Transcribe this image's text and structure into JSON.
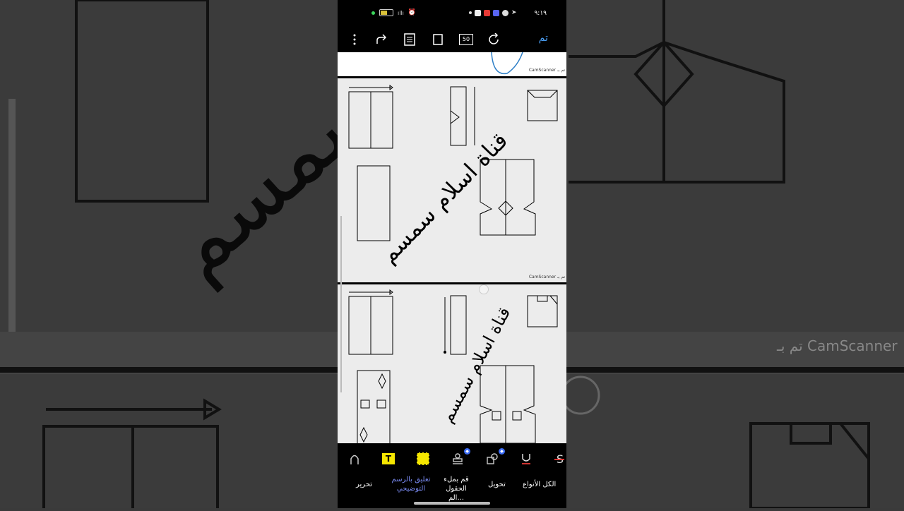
{
  "status_bar": {
    "time": "٩:١٩"
  },
  "toolbar": {
    "done_label": "تم",
    "zoom_badge": "50"
  },
  "document": {
    "watermark": "CamScanner تم بـ",
    "page1_handwriting": "قناة اسلام سمسم",
    "page2_handwriting": "قناة اسلام سمسم"
  },
  "bottom_bar": {
    "tools": [
      {
        "label": "الكل الأنواع",
        "icon": "underline-icon"
      },
      {
        "label": "تحويل",
        "icon": "shapes-icon"
      },
      {
        "label": "قم بملء الحقول الم...",
        "icon": "stamp-icon"
      },
      {
        "label": "تعليق بالرسم التوضيحي",
        "icon": "highlight-icon",
        "active": true
      },
      {
        "label": "تحرير",
        "icon": "pen-icon"
      }
    ]
  },
  "background": {
    "watermark": "CamScanner تم بـ",
    "handwriting": "سمسم"
  },
  "colors": {
    "accent": "#4a9ff5",
    "highlight": "#f5e600",
    "active_label": "#7b8cf5",
    "badge": "#3b6cf6"
  }
}
